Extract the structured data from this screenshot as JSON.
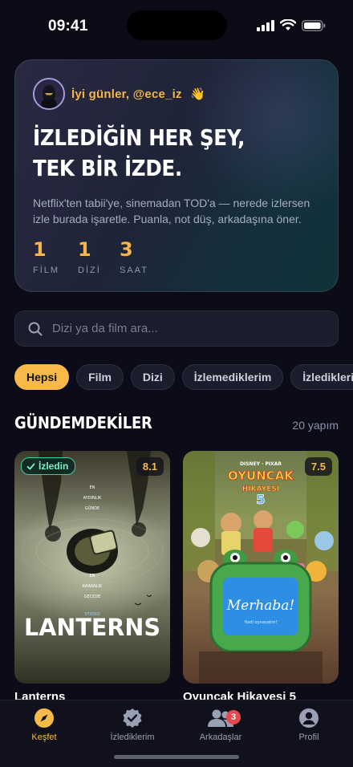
{
  "status": {
    "time": "09:41"
  },
  "hero": {
    "greeting": "İyi günler, @ece_iz",
    "wave": "👋",
    "title_line1": "İZLEDİĞİN HER ŞEY,",
    "title_line2": "TEK BİR İZDE.",
    "description": "Netflix'ten tabii'ye, sinemadan TOD'a — nerede izlersen izle burada işaretle. Puanla, not düş, arkadaşına öner.",
    "stats": [
      {
        "value": "1",
        "label": "FİLM"
      },
      {
        "value": "1",
        "label": "DİZİ"
      },
      {
        "value": "3",
        "label": "SAAT"
      }
    ]
  },
  "search": {
    "placeholder": "Dizi ya da film ara..."
  },
  "chips": [
    "Hepsi",
    "Film",
    "Dizi",
    "İzlemediklerim",
    "İzlediklerim"
  ],
  "section": {
    "title": "GÜNDEMDEKİLER",
    "count": "20 yapım"
  },
  "cards": [
    {
      "title": "Lanterns",
      "rating": "8.1",
      "badge": "İzledin",
      "poster_text": [
        "EN",
        "AYDINLIK",
        "GÜNDE",
        "EN",
        "KARANLIK",
        "GECEDE"
      ],
      "poster_brand": "STUDIO",
      "poster_title": "LANTERNS"
    },
    {
      "title": "Oyuncak Hikayesi 5",
      "rating": "7.5",
      "poster_top": "DISNEY · PIXAR",
      "poster_title_a": "OYUNCAK",
      "poster_title_b": "HİKAYESİ",
      "poster_number": "5",
      "screen_text": "Merhaba!",
      "screen_sub": "Hadi oynayalım!"
    }
  ],
  "tabs": [
    {
      "label": "Keşfet",
      "icon": "compass-icon"
    },
    {
      "label": "İzlediklerim",
      "icon": "badge-check-icon"
    },
    {
      "label": "Arkadaşlar",
      "icon": "users-icon",
      "badge": "3"
    },
    {
      "label": "Profil",
      "icon": "profile-icon"
    }
  ],
  "colors": {
    "accent": "#f6b94a",
    "background": "#0c0c18",
    "watched": "#3ecf9a",
    "badge": "#e5484d"
  }
}
